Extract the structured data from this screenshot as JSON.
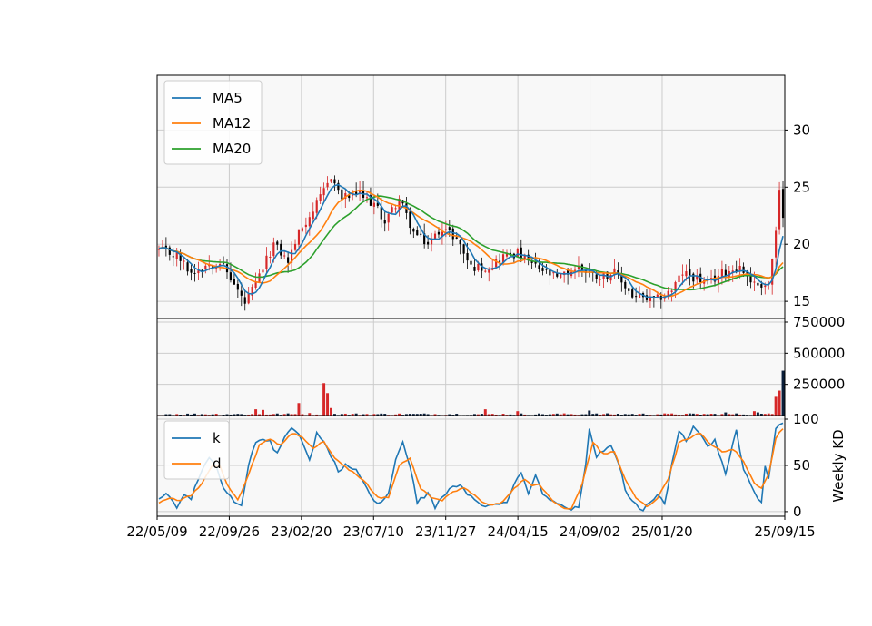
{
  "chart_data": {
    "type": "candlestick",
    "colors": {
      "panel_bg": "#f8f8f8",
      "grid": "#cccccc",
      "up": "#d62728",
      "down": "#000000",
      "ma5": "#1f77b4",
      "ma12": "#ff7f0e",
      "ma20": "#2ca02c",
      "k": "#1f77b4",
      "d": "#ff7f0e",
      "vol_up": "#d62728",
      "vol_down": "#0b1f3a"
    },
    "x_ticks": [
      "22/05/09",
      "22/09/26",
      "23/02/20",
      "23/07/10",
      "23/11/27",
      "24/04/15",
      "24/09/02",
      "25/01/20",
      "25/09/15"
    ],
    "x_tick_positions_week": [
      0,
      20,
      40,
      60,
      80,
      100,
      120,
      140,
      174
    ],
    "week_count": 175,
    "price_panel": {
      "ylim": [
        13.5,
        34.8
      ],
      "yticks": [
        "15",
        "20",
        "25",
        "30"
      ],
      "legend": [
        "MA5",
        "MA12",
        "MA20"
      ],
      "legend_position": "upper-left",
      "price_anchors": [
        [
          0,
          19.5
        ],
        [
          5,
          19
        ],
        [
          9,
          17.5
        ],
        [
          13,
          18.2
        ],
        [
          17,
          18.5
        ],
        [
          20,
          17
        ],
        [
          24,
          14.8
        ],
        [
          27,
          16.5
        ],
        [
          32,
          20
        ],
        [
          36,
          18.5
        ],
        [
          39,
          21
        ],
        [
          42,
          22.5
        ],
        [
          45,
          24
        ],
        [
          48,
          26
        ],
        [
          51,
          24
        ],
        [
          55,
          24.5
        ],
        [
          60,
          23.5
        ],
        [
          63,
          22
        ],
        [
          67,
          24
        ],
        [
          71,
          21
        ],
        [
          75,
          20
        ],
        [
          79,
          21.5
        ],
        [
          83,
          20.5
        ],
        [
          87,
          18
        ],
        [
          92,
          18
        ],
        [
          96,
          19
        ],
        [
          100,
          19.2
        ],
        [
          105,
          18
        ],
        [
          111,
          17
        ],
        [
          117,
          18
        ],
        [
          122,
          17.2
        ],
        [
          127,
          17.5
        ],
        [
          132,
          15.5
        ],
        [
          138,
          15
        ],
        [
          143,
          16
        ],
        [
          146,
          17.5
        ],
        [
          150,
          17
        ],
        [
          153,
          16.5
        ],
        [
          157,
          17.5
        ],
        [
          162,
          18
        ],
        [
          166,
          16.5
        ],
        [
          170,
          16.5
        ],
        [
          172,
          21
        ],
        [
          173,
          24.5
        ],
        [
          174,
          22
        ]
      ]
    },
    "volume_panel": {
      "ylim": [
        0,
        750000
      ],
      "yticks": [
        "250000",
        "500000",
        "750000"
      ],
      "spikes": [
        [
          27,
          50000
        ],
        [
          29,
          45000
        ],
        [
          39,
          100000
        ],
        [
          42,
          20000
        ],
        [
          46,
          260000
        ],
        [
          47,
          180000
        ],
        [
          48,
          60000
        ],
        [
          91,
          50000
        ],
        [
          100,
          35000
        ],
        [
          120,
          40000
        ],
        [
          158,
          25000
        ],
        [
          166,
          35000
        ],
        [
          167,
          25000
        ],
        [
          172,
          150000
        ],
        [
          173,
          200000
        ],
        [
          174,
          360000
        ]
      ]
    },
    "kd_panel": {
      "ylim": [
        -5,
        100
      ],
      "yticks": [
        "0",
        "50",
        "100"
      ],
      "ylabel": "Weekly KD",
      "legend": [
        "k",
        "d"
      ],
      "legend_position": "upper-left",
      "k_anchors": [
        [
          0,
          15
        ],
        [
          2,
          20
        ],
        [
          4,
          10
        ],
        [
          5,
          5
        ],
        [
          7,
          20
        ],
        [
          9,
          15
        ],
        [
          11,
          35
        ],
        [
          14,
          58
        ],
        [
          16,
          48
        ],
        [
          18,
          25
        ],
        [
          21,
          10
        ],
        [
          23,
          5
        ],
        [
          25,
          50
        ],
        [
          27,
          75
        ],
        [
          29,
          80
        ],
        [
          31,
          75
        ],
        [
          33,
          62
        ],
        [
          35,
          80
        ],
        [
          37,
          92
        ],
        [
          39,
          85
        ],
        [
          42,
          55
        ],
        [
          44,
          85
        ],
        [
          46,
          75
        ],
        [
          48,
          60
        ],
        [
          50,
          45
        ],
        [
          52,
          50
        ],
        [
          55,
          45
        ],
        [
          58,
          25
        ],
        [
          60,
          10
        ],
        [
          62,
          10
        ],
        [
          64,
          20
        ],
        [
          66,
          55
        ],
        [
          68,
          75
        ],
        [
          70,
          50
        ],
        [
          72,
          10
        ],
        [
          75,
          20
        ],
        [
          77,
          5
        ],
        [
          79,
          15
        ],
        [
          81,
          25
        ],
        [
          84,
          30
        ],
        [
          86,
          20
        ],
        [
          88,
          15
        ],
        [
          91,
          5
        ],
        [
          94,
          8
        ],
        [
          97,
          10
        ],
        [
          99,
          30
        ],
        [
          101,
          40
        ],
        [
          103,
          20
        ],
        [
          105,
          38
        ],
        [
          107,
          20
        ],
        [
          110,
          10
        ],
        [
          113,
          5
        ],
        [
          115,
          2
        ],
        [
          117,
          5
        ],
        [
          119,
          50
        ],
        [
          120,
          90
        ],
        [
          122,
          60
        ],
        [
          124,
          65
        ],
        [
          126,
          70
        ],
        [
          128,
          55
        ],
        [
          130,
          25
        ],
        [
          132,
          10
        ],
        [
          135,
          2
        ],
        [
          137,
          10
        ],
        [
          139,
          20
        ],
        [
          141,
          10
        ],
        [
          143,
          50
        ],
        [
          145,
          88
        ],
        [
          147,
          75
        ],
        [
          149,
          92
        ],
        [
          151,
          85
        ],
        [
          153,
          70
        ],
        [
          155,
          78
        ],
        [
          158,
          40
        ],
        [
          161,
          88
        ],
        [
          163,
          45
        ],
        [
          166,
          20
        ],
        [
          168,
          10
        ],
        [
          169,
          50
        ],
        [
          170,
          35
        ],
        [
          172,
          90
        ],
        [
          174,
          95
        ]
      ],
      "d_anchors": [
        [
          0,
          10
        ],
        [
          3,
          15
        ],
        [
          6,
          12
        ],
        [
          9,
          18
        ],
        [
          12,
          30
        ],
        [
          15,
          50
        ],
        [
          17,
          50
        ],
        [
          19,
          30
        ],
        [
          22,
          12
        ],
        [
          25,
          40
        ],
        [
          28,
          72
        ],
        [
          31,
          78
        ],
        [
          34,
          72
        ],
        [
          37,
          85
        ],
        [
          40,
          80
        ],
        [
          43,
          68
        ],
        [
          46,
          76
        ],
        [
          49,
          58
        ],
        [
          52,
          48
        ],
        [
          55,
          40
        ],
        [
          58,
          30
        ],
        [
          61,
          15
        ],
        [
          64,
          15
        ],
        [
          67,
          50
        ],
        [
          70,
          58
        ],
        [
          73,
          25
        ],
        [
          76,
          15
        ],
        [
          79,
          12
        ],
        [
          82,
          22
        ],
        [
          85,
          25
        ],
        [
          88,
          18
        ],
        [
          91,
          8
        ],
        [
          95,
          8
        ],
        [
          99,
          25
        ],
        [
          102,
          35
        ],
        [
          104,
          28
        ],
        [
          106,
          30
        ],
        [
          109,
          15
        ],
        [
          112,
          5
        ],
        [
          115,
          3
        ],
        [
          118,
          30
        ],
        [
          121,
          75
        ],
        [
          124,
          62
        ],
        [
          127,
          65
        ],
        [
          130,
          35
        ],
        [
          133,
          15
        ],
        [
          136,
          5
        ],
        [
          139,
          15
        ],
        [
          142,
          35
        ],
        [
          145,
          75
        ],
        [
          148,
          80
        ],
        [
          151,
          85
        ],
        [
          154,
          72
        ],
        [
          157,
          65
        ],
        [
          160,
          68
        ],
        [
          163,
          55
        ],
        [
          166,
          30
        ],
        [
          168,
          25
        ],
        [
          170,
          40
        ],
        [
          172,
          80
        ],
        [
          174,
          90
        ]
      ]
    }
  }
}
